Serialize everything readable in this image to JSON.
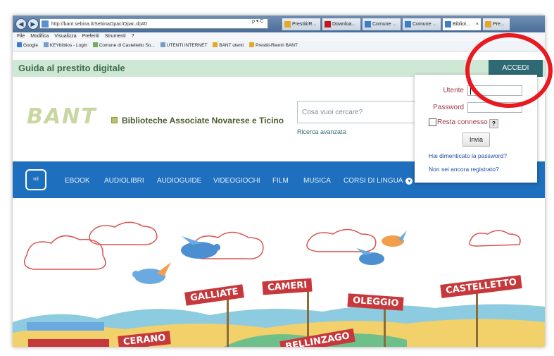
{
  "browser": {
    "address": "http://bant.sebina.it/SebinaOpac/Opac.do#0",
    "address_tools": "ρ ▾ C",
    "tabs": [
      {
        "label": "Prestiti/R...",
        "icon_color": "#e3a82a"
      },
      {
        "label": "Downloa...",
        "icon_color": "#c4161c"
      },
      {
        "label": "Comune ...",
        "icon_color": "#3d7fc7"
      },
      {
        "label": "Comune ...",
        "icon_color": "#3d7fc7"
      },
      {
        "label": "Bibliot...",
        "icon_color": "#3d7fc7"
      },
      {
        "label": "Pre...",
        "icon_color": "#e3a82a"
      }
    ],
    "tab_close": "×",
    "menu": [
      "File",
      "Modifica",
      "Visualizza",
      "Preferiti",
      "Strumenti",
      "?"
    ],
    "favorites": [
      {
        "label": "Google",
        "color": "#3a7bd5"
      },
      {
        "label": "KEYbiblios - Login",
        "color": "#7a9cc9"
      },
      {
        "label": "Comune di Castelletto So...",
        "color": "#6fae5a"
      },
      {
        "label": "UTENTI INTERNET",
        "color": "#7a9cc9"
      },
      {
        "label": "BANT utenti",
        "color": "#e3a82a"
      },
      {
        "label": "Prestiti-Rientri BANT",
        "color": "#e3a82a"
      }
    ]
  },
  "header": {
    "guide_title": "Guida al prestito digitale",
    "login_button": "ACCEDI",
    "logo": "BANT",
    "subtitle": "Biblioteche Associate Novarese e Ticino",
    "search_placeholder": "Cosa vuoi cercare?",
    "advanced_search": "Ricerca avanzata"
  },
  "nav": {
    "logo_text": "ml",
    "items": [
      "EBOOK",
      "AUDIOLIBRI",
      "AUDIOGUIDE",
      "VIDEOGIOCHI",
      "FILM",
      "MUSICA",
      "CORSI DI LINGUA"
    ]
  },
  "login": {
    "user_label": "Utente",
    "password_label": "Password",
    "remember_label": "Resta connesso",
    "help": "?",
    "submit": "Invia",
    "forgot": "Hai dimenticato la password?",
    "register": "Non sei ancora registrato?"
  },
  "banner": {
    "cities": [
      "GALLIATE",
      "CAMERI",
      "OLEGGIO",
      "CASTELLETTO",
      "CERANO",
      "BELLINZAGO"
    ]
  },
  "colors": {
    "accent": "#2e6a73",
    "nav": "#1e6fbd",
    "annotation": "#e8191f"
  }
}
